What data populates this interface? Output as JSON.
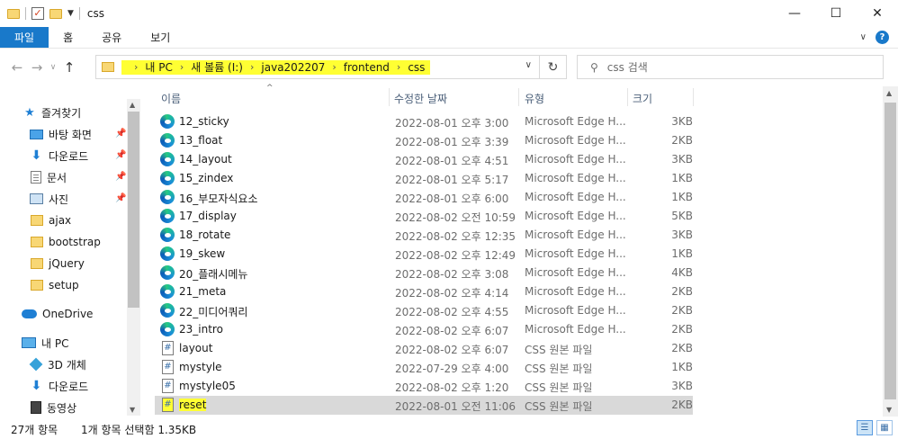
{
  "window": {
    "title": "css",
    "controls": {
      "minimize": "—",
      "maximize": "☐",
      "close": "✕"
    }
  },
  "ribbon": {
    "tabs": [
      "파일",
      "홈",
      "공유",
      "보기"
    ]
  },
  "nav": {
    "breadcrumbs": [
      "내 PC",
      "새 볼륨 (I:)",
      "java202207",
      "frontend",
      "css"
    ],
    "search_placeholder": "css 검색"
  },
  "sidebar": {
    "items": [
      {
        "label": "즐겨찾기",
        "icon": "star-icon"
      },
      {
        "label": "바탕 화면",
        "icon": "desktop-icon",
        "pinned": true
      },
      {
        "label": "다운로드",
        "icon": "download-icon",
        "pinned": true
      },
      {
        "label": "문서",
        "icon": "document-icon",
        "pinned": true
      },
      {
        "label": "사진",
        "icon": "pictures-icon",
        "pinned": true
      },
      {
        "label": "ajax",
        "icon": "folder-icon"
      },
      {
        "label": "bootstrap",
        "icon": "folder-icon"
      },
      {
        "label": "jQuery",
        "icon": "folder-icon"
      },
      {
        "label": "setup",
        "icon": "folder-icon"
      },
      {
        "label": "OneDrive",
        "icon": "cloud-icon"
      },
      {
        "label": "내 PC",
        "icon": "pc-icon"
      },
      {
        "label": "3D 개체",
        "icon": "3d-objects-icon"
      },
      {
        "label": "다운로드",
        "icon": "download-icon"
      },
      {
        "label": "동영상",
        "icon": "video-icon"
      }
    ]
  },
  "list": {
    "columns": {
      "name": "이름",
      "date": "수정한 날짜",
      "type": "유형",
      "size": "크기"
    },
    "rows": [
      {
        "name": "12_sticky",
        "date": "2022-08-01 오후 3:00",
        "type": "Microsoft Edge H...",
        "size": "3KB",
        "icon": "edge-html-icon"
      },
      {
        "name": "13_float",
        "date": "2022-08-01 오후 3:39",
        "type": "Microsoft Edge H...",
        "size": "2KB",
        "icon": "edge-html-icon"
      },
      {
        "name": "14_layout",
        "date": "2022-08-01 오후 4:51",
        "type": "Microsoft Edge H...",
        "size": "3KB",
        "icon": "edge-html-icon"
      },
      {
        "name": "15_zindex",
        "date": "2022-08-01 오후 5:17",
        "type": "Microsoft Edge H...",
        "size": "1KB",
        "icon": "edge-html-icon"
      },
      {
        "name": "16_부모자식요소",
        "date": "2022-08-01 오후 6:00",
        "type": "Microsoft Edge H...",
        "size": "1KB",
        "icon": "edge-html-icon"
      },
      {
        "name": "17_display",
        "date": "2022-08-02 오전 10:59",
        "type": "Microsoft Edge H...",
        "size": "5KB",
        "icon": "edge-html-icon"
      },
      {
        "name": "18_rotate",
        "date": "2022-08-02 오후 12:35",
        "type": "Microsoft Edge H...",
        "size": "3KB",
        "icon": "edge-html-icon"
      },
      {
        "name": "19_skew",
        "date": "2022-08-02 오후 12:49",
        "type": "Microsoft Edge H...",
        "size": "1KB",
        "icon": "edge-html-icon"
      },
      {
        "name": "20_플래시메뉴",
        "date": "2022-08-02 오후 3:08",
        "type": "Microsoft Edge H...",
        "size": "4KB",
        "icon": "edge-html-icon"
      },
      {
        "name": "21_meta",
        "date": "2022-08-02 오후 4:14",
        "type": "Microsoft Edge H...",
        "size": "2KB",
        "icon": "edge-html-icon"
      },
      {
        "name": "22_미디어쿼리",
        "date": "2022-08-02 오후 4:55",
        "type": "Microsoft Edge H...",
        "size": "2KB",
        "icon": "edge-html-icon"
      },
      {
        "name": "23_intro",
        "date": "2022-08-02 오후 6:07",
        "type": "Microsoft Edge H...",
        "size": "2KB",
        "icon": "edge-html-icon"
      },
      {
        "name": "layout",
        "date": "2022-08-02 오후 6:07",
        "type": "CSS 원본 파일",
        "size": "2KB",
        "icon": "css-file-icon"
      },
      {
        "name": "mystyle",
        "date": "2022-07-29 오후 4:00",
        "type": "CSS 원본 파일",
        "size": "1KB",
        "icon": "css-file-icon"
      },
      {
        "name": "mystyle05",
        "date": "2022-08-02 오후 1:20",
        "type": "CSS 원본 파일",
        "size": "3KB",
        "icon": "css-file-icon"
      },
      {
        "name": "reset",
        "date": "2022-08-01 오전 11:06",
        "type": "CSS 원본 파일",
        "size": "2KB",
        "icon": "css-file-icon",
        "selected": true
      }
    ]
  },
  "status": {
    "item_count": "27개 항목",
    "selection": "1개 항목 선택함 1.35KB"
  },
  "colors": {
    "accent": "#1979ca",
    "highlight": "#ffff33",
    "selected_row": "#d9d9d9"
  }
}
